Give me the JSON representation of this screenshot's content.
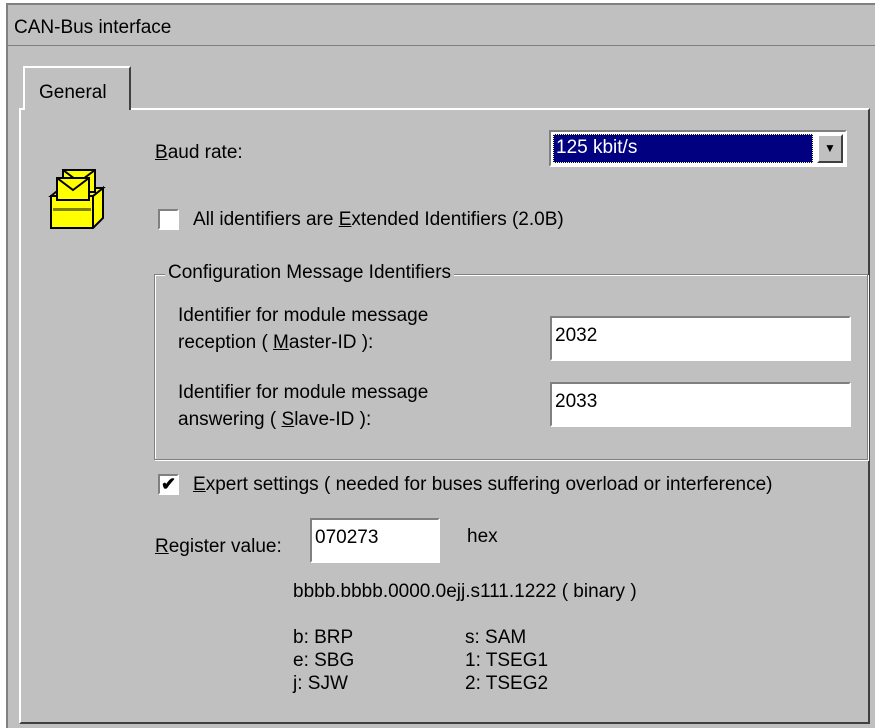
{
  "window": {
    "title": "CAN-Bus interface"
  },
  "tabs": [
    {
      "label": "General"
    }
  ],
  "baud_rate": {
    "label_underlined": "B",
    "label_rest": "aud rate:",
    "value": "125 kbit/s"
  },
  "extended_identifiers": {
    "checked": false,
    "label_before": "All identifiers are ",
    "label_underlined": "E",
    "label_after": "xtended Identifiers (2.0B)"
  },
  "config_group": {
    "title": "Configuration Message Identifiers",
    "master": {
      "line1": "Identifier for module message",
      "line2_before": "reception ( ",
      "line2_underlined": "M",
      "line2_after": "aster-ID ):",
      "value": "2032"
    },
    "slave": {
      "line1": "Identifier for module message",
      "line2_before": "answering ( ",
      "line2_underlined": "S",
      "line2_after": "lave-ID ):",
      "value": "2033"
    }
  },
  "expert_settings": {
    "checked": true,
    "check_glyph": "✔",
    "label_underlined": "E",
    "label_rest": "xpert settings ( needed for buses suffering overload or interference)"
  },
  "register": {
    "label_underlined": "R",
    "label_rest": "egister value:",
    "value": "070273",
    "unit": "hex",
    "binary_format": "bbbb.bbbb.0000.0ejj.s111.1222 ( binary )"
  },
  "legend": {
    "left": [
      "b: BRP",
      "e: SBG",
      "j:  SJW"
    ],
    "right": [
      "s: SAM",
      "1: TSEG1",
      "2: TSEG2"
    ]
  },
  "icons": {
    "module_icon": "envelope-inbox-tray-icon",
    "dropdown_arrow": "▼"
  },
  "colors": {
    "face": "#c0c0c0",
    "selection": "#000080",
    "icon_yellow": "#ffff00"
  }
}
